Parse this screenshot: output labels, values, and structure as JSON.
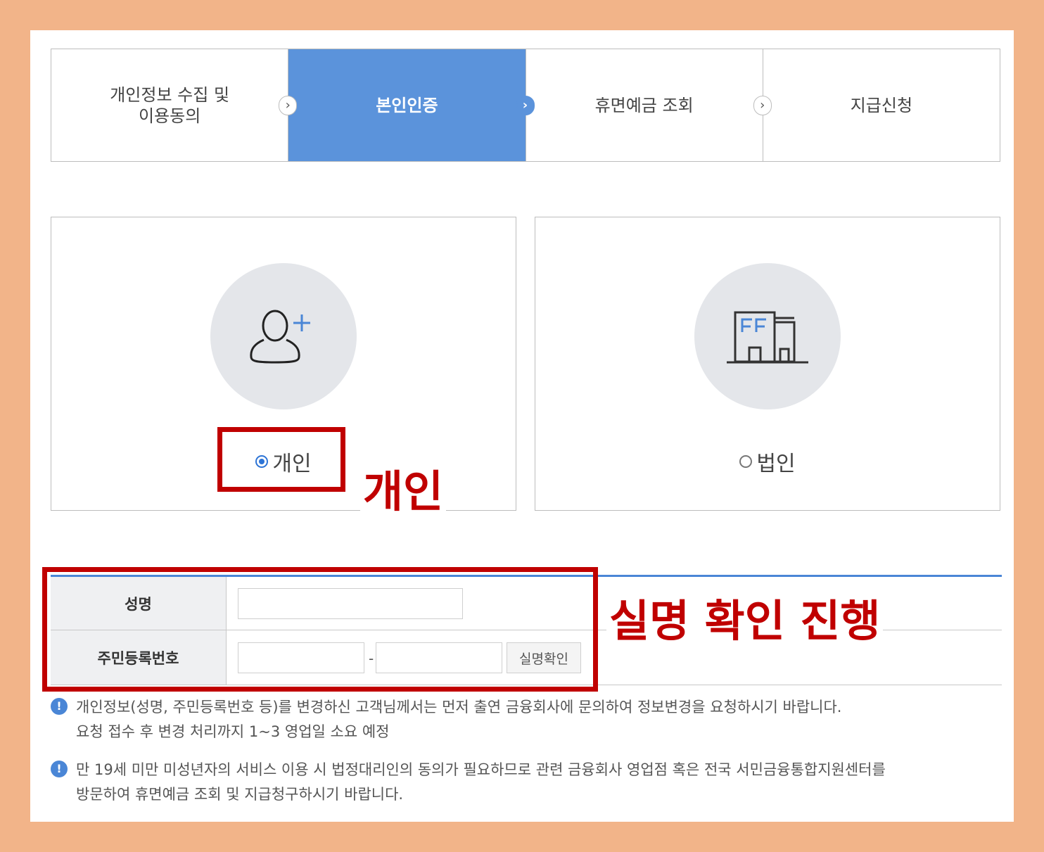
{
  "steps": [
    {
      "line1": "개인정보 수집 및",
      "line2": "이용동의",
      "active": false
    },
    {
      "label": "본인인증",
      "active": true
    },
    {
      "label": "휴면예금 조회",
      "active": false
    },
    {
      "label": "지급신청",
      "active": false
    }
  ],
  "step_arrow_glyph": "›",
  "types": {
    "personal": {
      "label": "개인",
      "icon": "person-add-icon",
      "selected": true
    },
    "corporate": {
      "label": "법인",
      "icon": "building-icon",
      "selected": false
    }
  },
  "annotations": {
    "personal": "개인",
    "form": "실명 확인 진행"
  },
  "form": {
    "name_label": "성명",
    "rrn_label": "주민등록번호",
    "separator": "-",
    "verify_button": "실명확인"
  },
  "notices": [
    {
      "line1": "개인정보(성명, 주민등록번호 등)를 변경하신 고객님께서는 먼저 출연 금융회사에 문의하여 정보변경을 요청하시기 바랍니다.",
      "line2": "요청 접수 후 변경 처리까지 1~3 영업일 소요 예정"
    },
    {
      "line1": "만 19세 미만 미성년자의 서비스 이용 시 법정대리인의 동의가 필요하므로 관련 금융회사 영업점 혹은 전국 서민금융통합지원센터를",
      "line2": "방문하여 휴면예금 조회 및 지급청구하시기 바랍니다."
    }
  ],
  "notice_icon_glyph": "!",
  "colors": {
    "border_frame": "#f2b489",
    "active_step": "#5b93db",
    "annotation_red": "#c00000",
    "accent_blue": "#4a86d6"
  }
}
